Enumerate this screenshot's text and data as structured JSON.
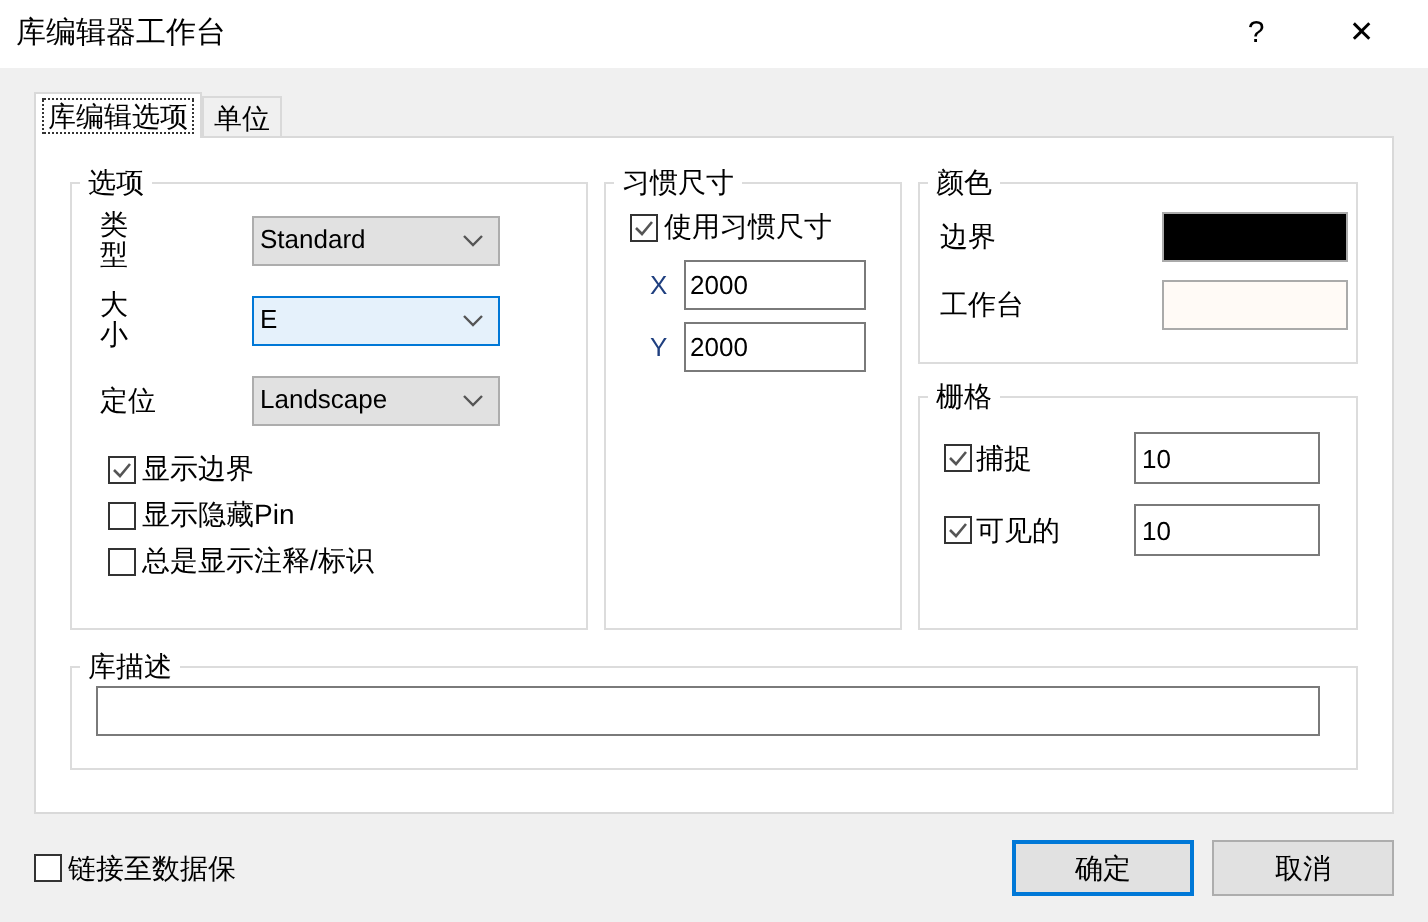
{
  "window": {
    "title": "库编辑器工作台",
    "help": "?",
    "close": "✕"
  },
  "tabs": [
    {
      "label": "库编辑选项",
      "selected": true
    },
    {
      "label": "单位",
      "selected": false
    }
  ],
  "options": {
    "title": "选项",
    "fields": [
      {
        "label": "类型",
        "value": "Standard",
        "focused": false
      },
      {
        "label": "大小",
        "value": "E",
        "focused": true
      },
      {
        "label": "定位",
        "value": "Landscape",
        "focused": false
      }
    ],
    "checkboxes": [
      {
        "label": "显示边界",
        "checked": true
      },
      {
        "label": "显示隐藏Pin",
        "checked": false
      },
      {
        "label": "总是显示注释/标识",
        "checked": false
      }
    ]
  },
  "custom_size": {
    "title": "习惯尺寸",
    "use": {
      "label": "使用习惯尺寸",
      "checked": true
    },
    "fields": [
      {
        "label": "X",
        "value": "2000"
      },
      {
        "label": "Y",
        "value": "2000"
      }
    ]
  },
  "colors": {
    "title": "颜色",
    "items": [
      {
        "label": "边界",
        "color": "#000000"
      },
      {
        "label": "工作台",
        "color": "#fffaf6"
      }
    ]
  },
  "grid": {
    "title": "栅格",
    "items": [
      {
        "label": "捕捉",
        "checked": true,
        "value": "10"
      },
      {
        "label": "可见的",
        "checked": true,
        "value": "10"
      }
    ]
  },
  "description": {
    "title": "库描述"
  },
  "link": {
    "label": "链接至数据保",
    "checked": false
  },
  "buttons": [
    {
      "label": "确定",
      "default": true
    },
    {
      "label": "取消",
      "default": false
    }
  ]
}
